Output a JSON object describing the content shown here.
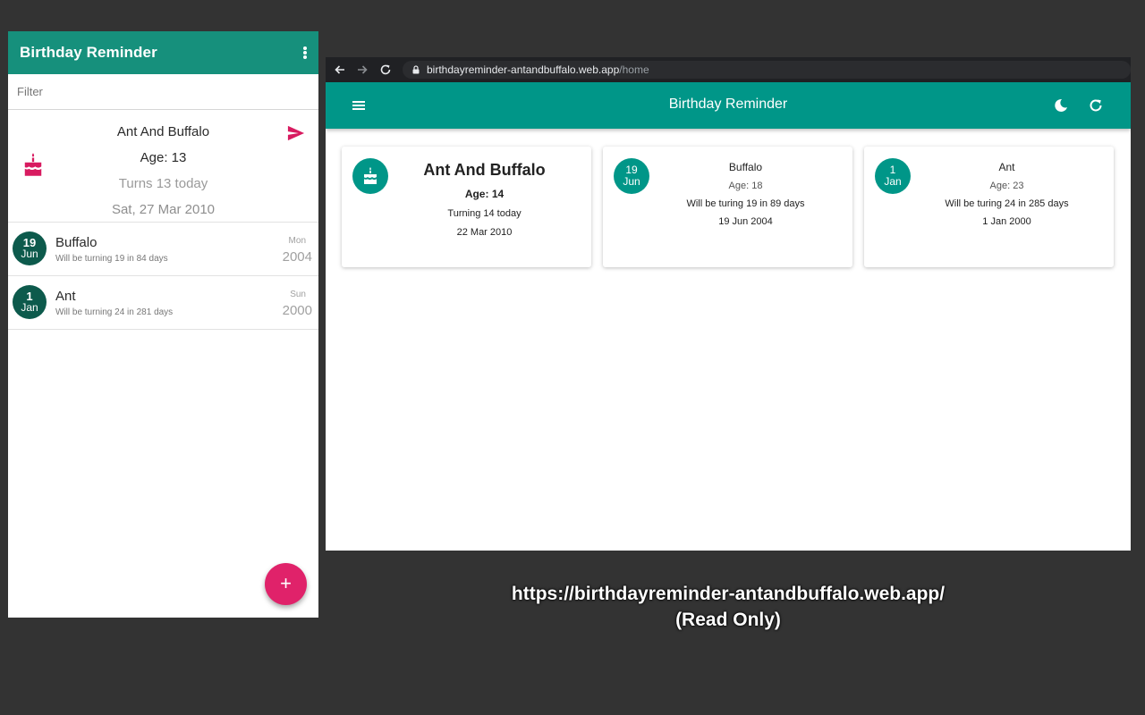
{
  "phone": {
    "title": "Birthday Reminder",
    "filter_placeholder": "Filter",
    "today": {
      "name": "Ant And Buffalo",
      "age": "Age: 13",
      "turns": "Turns 13 today",
      "date": "Sat, 27 Mar 2010"
    },
    "rows": [
      {
        "day": "19",
        "month": "Jun",
        "name": "Buffalo",
        "sub": "Will be turning 19 in 84 days",
        "dow": "Mon",
        "year": "2004"
      },
      {
        "day": "1",
        "month": "Jan",
        "name": "Ant",
        "sub": "Will be turning 24 in 281 days",
        "dow": "Sun",
        "year": "2000"
      }
    ],
    "fab_label": "+"
  },
  "browser": {
    "url_host": "birthdayreminder-antandbuffalo.web.app",
    "url_path": "/home",
    "app_title": "Birthday Reminder"
  },
  "cards": [
    {
      "name": "Ant And Buffalo",
      "age": "Age: 14",
      "sub": "Turning 14 today",
      "date": "22 Mar 2010"
    },
    {
      "day": "19",
      "month": "Jun",
      "name": "Buffalo",
      "age": "Age: 18",
      "sub": "Will be turing 19 in 89 days",
      "date": "19 Jun 2004"
    },
    {
      "day": "1",
      "month": "Jan",
      "name": "Ant",
      "age": "Age: 23",
      "sub": "Will be turing 24 in 285 days",
      "date": "1 Jan 2000"
    }
  ],
  "caption": {
    "line1": "https://birthdayreminder-antandbuffalo.web.app/",
    "line2": "(Read Only)"
  },
  "colors": {
    "teal": "#009688",
    "phone_appbar": "#16907c",
    "badge_dark": "#0d5a4c",
    "accent_pink": "#e0226a",
    "background": "#333333"
  },
  "icons": [
    "more-vert-icon",
    "cake-icon",
    "send-icon",
    "menu-icon",
    "dark-mode-icon",
    "refresh-icon",
    "back-arrow-icon",
    "forward-arrow-icon",
    "reload-icon",
    "lock-icon"
  ]
}
